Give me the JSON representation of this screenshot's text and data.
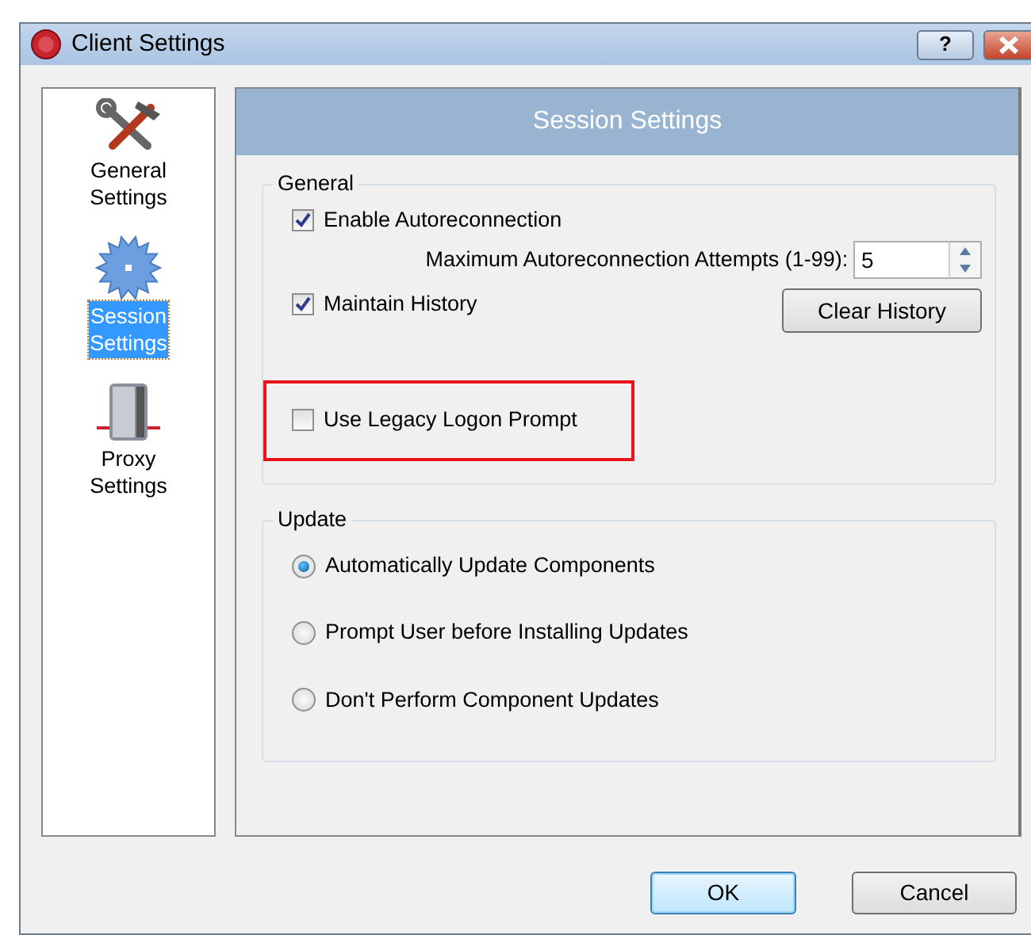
{
  "window": {
    "title": "Client Settings",
    "help_button": "?"
  },
  "sidebar": {
    "items": [
      {
        "label": "General Settings",
        "kind": "tools",
        "selected": false
      },
      {
        "label": "Session Settings",
        "kind": "gear",
        "selected": true
      },
      {
        "label": "Proxy Settings",
        "kind": "server",
        "selected": false
      }
    ]
  },
  "panel": {
    "title": "Session Settings",
    "general": {
      "title": "General",
      "enable_autoreconnection": {
        "label": "Enable Autoreconnection",
        "checked": true
      },
      "max_attempts": {
        "label": "Maximum Autoreconnection Attempts (1-99):",
        "value": "5"
      },
      "maintain_history": {
        "label": "Maintain History",
        "checked": true
      },
      "clear_history": "Clear History",
      "legacy_logon": {
        "label": "Use Legacy Logon Prompt",
        "checked": false,
        "highlighted": true
      }
    },
    "update": {
      "title": "Update",
      "options": [
        {
          "label": "Automatically Update Components",
          "selected": true
        },
        {
          "label": "Prompt User before Installing Updates",
          "selected": false
        },
        {
          "label": "Don't Perform Component Updates",
          "selected": false
        }
      ]
    }
  },
  "buttons": [
    {
      "label": "OK",
      "default": true
    },
    {
      "label": "Cancel",
      "default": false
    }
  ]
}
